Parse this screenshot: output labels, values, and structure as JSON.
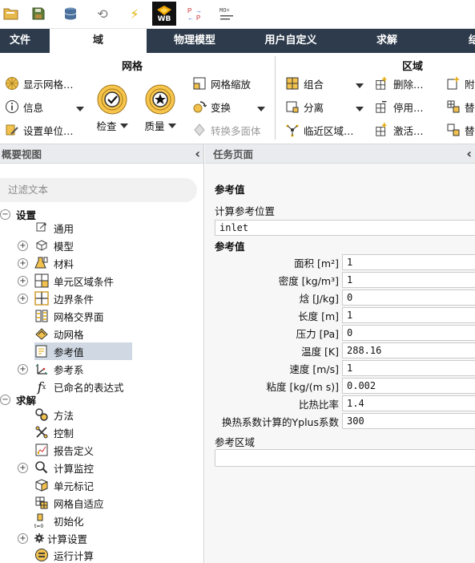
{
  "quick_access": {
    "wb_label": "WB",
    "icons": [
      "open-file-icon",
      "save-icon",
      "database-icon",
      "refresh-icon",
      "lightning-icon",
      "workbench-icon",
      "parameters-icon",
      "expression-icon"
    ]
  },
  "tabs": [
    {
      "label": "文件"
    },
    {
      "label": "域"
    },
    {
      "label": "物理模型"
    },
    {
      "label": "用户自定义"
    },
    {
      "label": "求解"
    },
    {
      "label": "结"
    }
  ],
  "ribbon": {
    "mesh_group": {
      "title": "网格",
      "show_mesh": "显示网格…",
      "info": "信息",
      "set_units": "设置单位…",
      "check": "检查",
      "quality": "质量",
      "scale": "网格缩放",
      "transform": "变换",
      "to_polyhedra": "转换多面体"
    },
    "zone_group": {
      "title": "区域",
      "combine": "组合",
      "separate": "分离",
      "adjacency": "临近区域…",
      "delete": "删除…",
      "deactivate": "停用…",
      "activate": "激活…",
      "append": "附",
      "replace": "替",
      "replace2": "替"
    }
  },
  "left_panel": {
    "title": "概要视图",
    "collapse_glyph": "‹",
    "filter_placeholder": "过滤文本",
    "tree": [
      {
        "label": "设置",
        "section": true
      },
      {
        "label": "通用"
      },
      {
        "label": "模型"
      },
      {
        "label": "材料"
      },
      {
        "label": "单元区域条件"
      },
      {
        "label": "边界条件"
      },
      {
        "label": "网格交界面"
      },
      {
        "label": "动网格"
      },
      {
        "label": "参考值",
        "selected": true
      },
      {
        "label": "参考系"
      },
      {
        "label": "已命名的表达式"
      },
      {
        "label": "求解",
        "section": true
      },
      {
        "label": "方法"
      },
      {
        "label": "控制"
      },
      {
        "label": "报告定义"
      },
      {
        "label": "计算监控"
      },
      {
        "label": "单元标记"
      },
      {
        "label": "网格自适应"
      },
      {
        "label": "初始化"
      },
      {
        "label": "计算设置"
      },
      {
        "label": "运行计算"
      }
    ]
  },
  "task_page": {
    "title": "任务页面",
    "collapse_glyph": "‹",
    "heading": "参考值",
    "compute_from_label": "计算参考位置",
    "compute_from_value": "inlet",
    "values_label": "参考值",
    "fields": [
      {
        "label": "面积 [m²]",
        "value": "1"
      },
      {
        "label": "密度 [kg/m³]",
        "value": "1"
      },
      {
        "label": "焓 [J/kg]",
        "value": "0"
      },
      {
        "label": "长度 [m]",
        "value": "1"
      },
      {
        "label": "压力 [Pa]",
        "value": "0"
      },
      {
        "label": "温度 [K]",
        "value": "288.16"
      },
      {
        "label": "速度 [m/s]",
        "value": "1"
      },
      {
        "label": "粘度 [kg/(m s)]",
        "value": "0.002"
      },
      {
        "label": "比热比率",
        "value": "1.4"
      },
      {
        "label": "换热系数计算的Yplus系数",
        "value": "300"
      }
    ],
    "zone_label": "参考区域",
    "zone_value": ""
  },
  "colors": {
    "tab_bar": "#2d3b4c",
    "selection": "#cfd8e3",
    "panel_header": "#e9ebee"
  }
}
